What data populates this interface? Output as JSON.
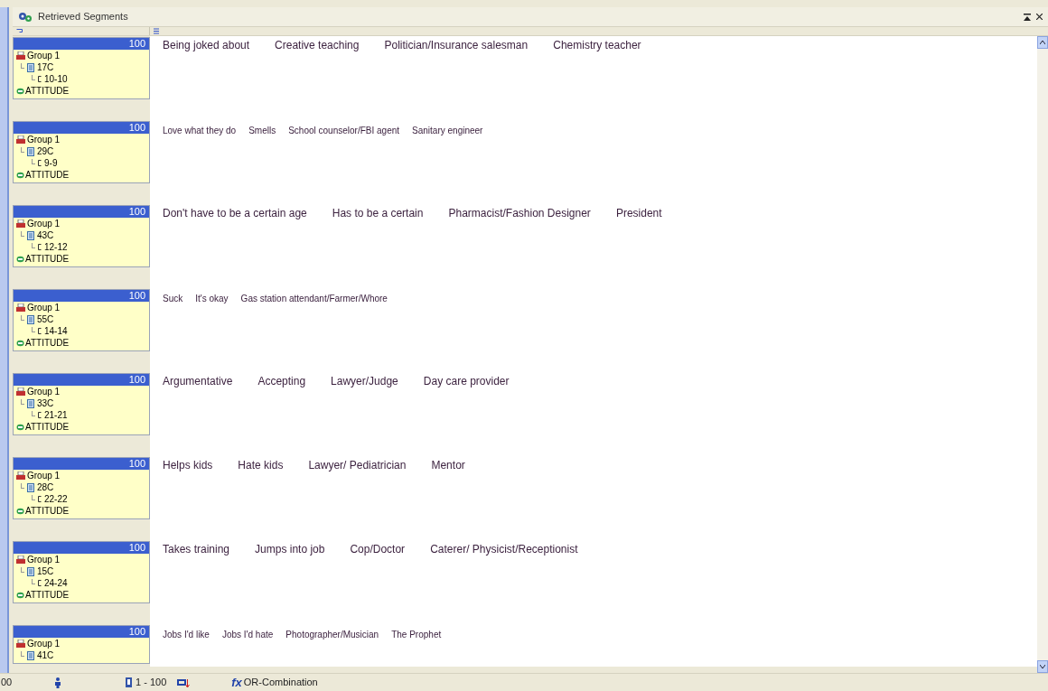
{
  "window": {
    "title": "Retrieved Segments"
  },
  "segments": [
    {
      "weight": "100",
      "group": "Group 1",
      "document": "17C",
      "range": "10-10",
      "code": "ATTITUDE",
      "kind": "large",
      "cells": [
        "Being joked about",
        "Creative teaching",
        "Politician/Insurance salesman",
        "Chemistry teacher"
      ]
    },
    {
      "weight": "100",
      "group": "Group 1",
      "document": "29C",
      "range": "9-9",
      "code": "ATTITUDE",
      "kind": "small",
      "cells": [
        "Love what they do",
        "Smells",
        "School counselor/FBI agent",
        "Sanitary engineer"
      ]
    },
    {
      "weight": "100",
      "group": "Group 1",
      "document": "43C",
      "range": "12-12",
      "code": "ATTITUDE",
      "kind": "large",
      "cells": [
        "Don't have to be a certain age",
        "Has to be a certain",
        "Pharmacist/Fashion Designer",
        "President"
      ]
    },
    {
      "weight": "100",
      "group": "Group 1",
      "document": "55C",
      "range": "14-14",
      "code": "ATTITUDE",
      "kind": "small",
      "cells": [
        "Suck",
        "It's okay",
        "Gas station attendant/Farmer/Whore"
      ]
    },
    {
      "weight": "100",
      "group": "Group 1",
      "document": "33C",
      "range": "21-21",
      "code": "ATTITUDE",
      "kind": "large",
      "cells": [
        "Argumentative",
        "Accepting",
        "Lawyer/Judge",
        "Day care provider"
      ]
    },
    {
      "weight": "100",
      "group": "Group 1",
      "document": "28C",
      "range": "22-22",
      "code": "ATTITUDE",
      "kind": "large",
      "cells": [
        "Helps kids",
        "Hate kids",
        "Lawyer/ Pediatrician",
        "Mentor"
      ]
    },
    {
      "weight": "100",
      "group": "Group 1",
      "document": "15C",
      "range": "24-24",
      "code": "ATTITUDE",
      "kind": "large",
      "cells": [
        "Takes training",
        "Jumps into job",
        "Cop/Doctor",
        "Caterer/ Physicist/Receptionist"
      ]
    },
    {
      "weight": "100",
      "group": "Group 1",
      "document": "41C",
      "kind": "small",
      "cells": [
        "Jobs I'd like",
        "Jobs I'd hate",
        "Photographer/Musician",
        "The Prophet"
      ]
    }
  ],
  "status_bar": {
    "count": "00",
    "range": "1 - 100",
    "function_symbol": "fx",
    "combination": "OR-Combination"
  }
}
